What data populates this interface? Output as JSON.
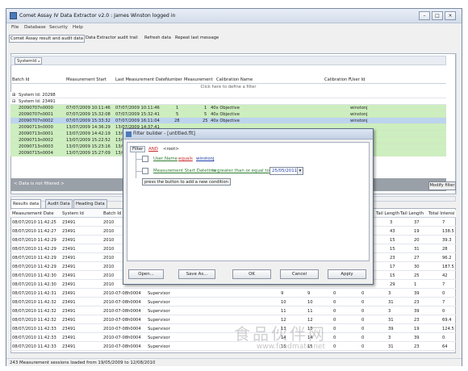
{
  "window": {
    "title": "Comet Assay IV Data Extractor v2.0 : James Winston logged in"
  },
  "menu": [
    "File",
    "Database",
    "Security",
    "Help"
  ],
  "toolbar": {
    "btn1": "Comet Assay result and audit data",
    "btn2": "Data Extractor audit trail",
    "btn3": "Refresh data",
    "btn4": "Repeat last message"
  },
  "grouping": {
    "chip": "SystemId"
  },
  "top_grid": {
    "headers": [
      "Batch Id",
      "Measurement Start",
      "Last Measurement Date",
      "Number",
      "Measurement",
      "Calibration Name",
      "Calibration F",
      "User Id"
    ],
    "filter_hint": "Click here to define a filter",
    "groups": [
      {
        "label": "System Id: 20298"
      },
      {
        "label": "System Id: 23491"
      }
    ],
    "rows": [
      [
        "20090707n0000",
        "07/07/2009 10:11:46",
        "07/07/2009 10:11:46",
        "1",
        "1",
        "40x Objective",
        "",
        "winstonj"
      ],
      [
        "20090707n0001",
        "07/07/2009 15:32:08",
        "07/07/2009 15:32:41",
        "5",
        "5",
        "40x Objective",
        "",
        "winstonj"
      ],
      [
        "20090707n0002",
        "07/07/2009 15:33:32",
        "07/07/2009 16:11:04",
        "28",
        "25",
        "40x Objective",
        "",
        "winstonj"
      ],
      [
        "20090713n0000",
        "13/07/2009 14:36:29",
        "13/07/2009 14:37:41",
        "",
        "",
        "",
        "",
        ""
      ],
      [
        "20090713n0001",
        "13/07/2009 14:42:19",
        "13/07/2009",
        "",
        "",
        "",
        "",
        ""
      ],
      [
        "20090713n0002",
        "13/07/2009 15:22:52",
        "13/07/2009",
        "",
        "",
        "",
        "",
        ""
      ],
      [
        "20090713n0003",
        "13/07/2009 15:23:16",
        "13/07/2009",
        "",
        "",
        "",
        "",
        ""
      ],
      [
        "20090715n0004",
        "13/07/2009 15:27:09",
        "13/07/2009",
        "",
        "",
        "",
        "",
        ""
      ]
    ],
    "filter_bar": "< Data is not filtered >",
    "modify_filter": "Modify filter"
  },
  "tabs": [
    "Results data",
    "Audit Data",
    "Heading Data"
  ],
  "bottom_grid": {
    "headers": [
      "Measurement Date",
      "System Id",
      "Batch Id",
      "Tail Length",
      "Tail Length",
      "Total Intensi"
    ],
    "rows": [
      [
        "08/07/2010 11:42:25",
        "23491",
        "2010",
        "3",
        "37",
        "7"
      ],
      [
        "08/07/2010 11:42:27",
        "23491",
        "2010",
        "43",
        "19",
        "138.5"
      ],
      [
        "08/07/2010 11:42:29",
        "23491",
        "2010",
        "15",
        "20",
        "39.3"
      ],
      [
        "08/07/2010 11:42:29",
        "23491",
        "2010",
        "15",
        "31",
        "28"
      ],
      [
        "08/07/2010 11:42:29",
        "23491",
        "2010",
        "23",
        "27",
        "96.2"
      ],
      [
        "08/07/2010 11:42:29",
        "23491",
        "2010",
        "17",
        "30",
        "187.5"
      ],
      [
        "08/07/2010 11:42:30",
        "23491",
        "2010",
        "15",
        "25",
        "42"
      ],
      [
        "08/07/2010 11:42:30",
        "23491",
        "2010",
        "29",
        "1",
        "7"
      ],
      [
        "08/07/2010 11:42:31",
        "23491",
        "2010-07-08h0004",
        "Supervisor",
        "9",
        "9",
        "0",
        "0",
        "3",
        "39",
        "0"
      ],
      [
        "08/07/2010 11:42:32",
        "23491",
        "2010-07-08h0004",
        "Supervisor",
        "10",
        "10",
        "0",
        "0",
        "31",
        "23",
        "7"
      ],
      [
        "08/07/2010 11:42:32",
        "23491",
        "2010-07-08h0004",
        "Supervisor",
        "11",
        "11",
        "0",
        "0",
        "3",
        "39",
        "0"
      ],
      [
        "08/07/2010 11:42:32",
        "23491",
        "2010-07-08h0004",
        "Supervisor",
        "12",
        "12",
        "0",
        "0",
        "31",
        "23",
        "69.4"
      ],
      [
        "08/07/2010 11:42:33",
        "23491",
        "2010-07-08h0004",
        "Supervisor",
        "13",
        "13",
        "0",
        "0",
        "39",
        "19",
        "124.5"
      ],
      [
        "08/07/2010 11:42:33",
        "23491",
        "2010-07-08h0004",
        "Supervisor",
        "14",
        "14",
        "0",
        "0",
        "3",
        "39",
        "0"
      ],
      [
        "08/07/2010 11:42:33",
        "23491",
        "2010-07-08h0004",
        "Supervisor",
        "15",
        "15",
        "0",
        "0",
        "31",
        "23",
        "64"
      ]
    ]
  },
  "status": "243 Measurement sessions loaded from 19/05/2009 to 12/08/2010",
  "dialog": {
    "title": "Filter builder - [untitled.flt]",
    "filter_label": "Filter",
    "and_label": "AND",
    "root_label": "<root>",
    "cond1": {
      "field": "User Name",
      "op": "equals",
      "value": "winstonj"
    },
    "cond2": {
      "field": "Measurement Start Datetime",
      "op": "is greater than or equal to",
      "value": "25/05/2011"
    },
    "add_hint": "press the button to add a new condition",
    "buttons": {
      "open": "Open...",
      "save": "Save As...",
      "ok": "OK",
      "cancel": "Cancel",
      "apply": "Apply"
    }
  },
  "watermark": {
    "cn": "食品伙伴网",
    "url": "www.foodmate.net"
  }
}
